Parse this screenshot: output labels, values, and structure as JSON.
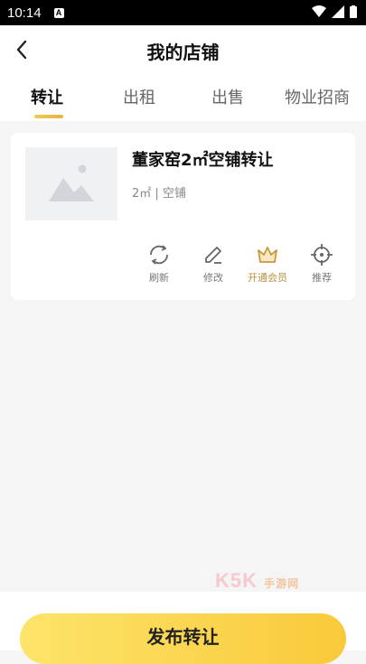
{
  "status_bar": {
    "time": "10:14",
    "notification_letter": "A"
  },
  "header": {
    "title": "我的店铺"
  },
  "tabs": [
    {
      "label": "转让",
      "active": true
    },
    {
      "label": "出租",
      "active": false
    },
    {
      "label": "出售",
      "active": false
    },
    {
      "label": "物业招商",
      "active": false
    }
  ],
  "listing": {
    "title": "董家窑2㎡空铺转让",
    "meta": "2㎡ | 空铺",
    "actions": [
      {
        "label": "刷新",
        "icon": "refresh-icon"
      },
      {
        "label": "修改",
        "icon": "edit-icon"
      },
      {
        "label": "开通会员",
        "icon": "crown-icon"
      },
      {
        "label": "推荐",
        "icon": "target-icon"
      }
    ]
  },
  "watermark": {
    "brand": "K5K",
    "sub": "手游网"
  },
  "footer": {
    "publish_label": "发布转让"
  },
  "colors": {
    "accent": "#f9c93a",
    "vip": "#b8913d"
  }
}
